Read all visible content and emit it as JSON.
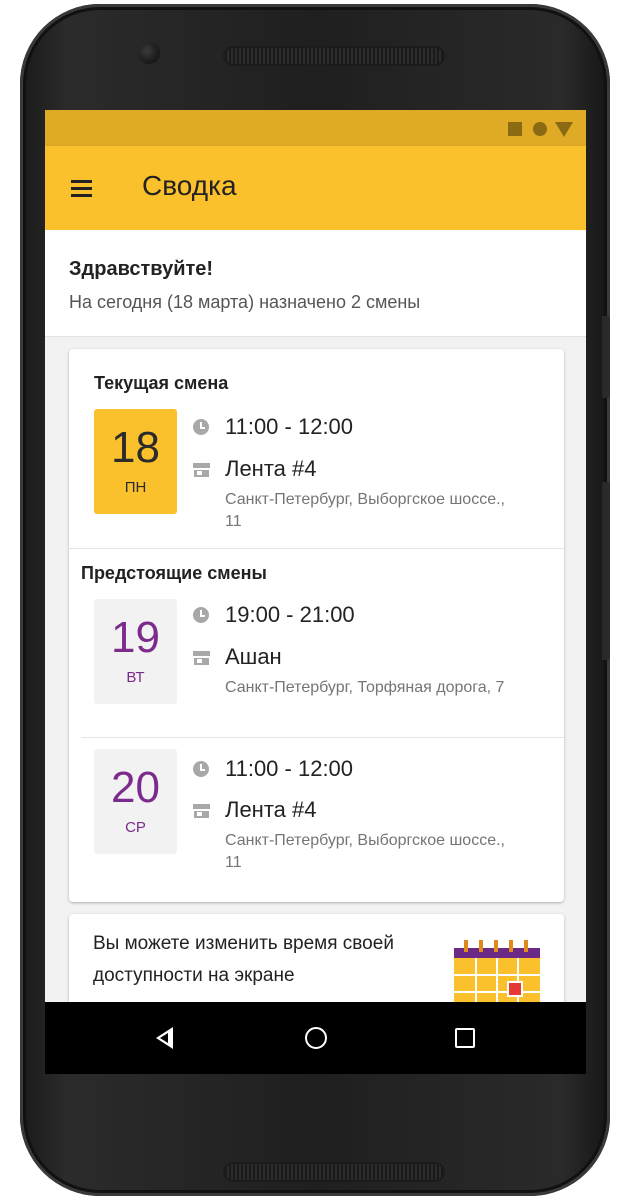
{
  "appbar": {
    "title": "Сводка",
    "menu_icon": "hamburger-menu-icon"
  },
  "status_bar": {
    "icons": [
      "square-icon",
      "circle-icon",
      "triangle-icon"
    ]
  },
  "greeting": {
    "title": "Здравствуйте!",
    "subtitle": "На сегодня (18 марта) назначено 2 смены"
  },
  "current_shift": {
    "section_title": "Текущая смена",
    "day": "18",
    "weekday": "ПН",
    "time": "11:00 - 12:00",
    "store": "Лента #4",
    "address": "Санкт-Петербург, Выборгское шоссе., 11"
  },
  "upcoming": {
    "section_title": "Предстоящие смены",
    "shifts": [
      {
        "day": "19",
        "weekday": "ВТ",
        "time": "19:00 - 21:00",
        "store": "Ашан",
        "address": "Санкт-Петербург, Торфяная дорога, 7"
      },
      {
        "day": "20",
        "weekday": "СР",
        "time": "11:00 - 12:00",
        "store": "Лента #4",
        "address": "Санкт-Петербург, Выборгское шоссе., 11"
      }
    ]
  },
  "info_card": {
    "text": "Вы можете изменить время своей доступности на экране",
    "icon": "calendar-icon"
  },
  "nav": {
    "icons": [
      "back-icon",
      "home-icon",
      "recents-icon"
    ]
  },
  "colors": {
    "accent": "#fbc12d",
    "status_bar": "#dfaa25",
    "weekday_purple": "#7b2b8c"
  }
}
